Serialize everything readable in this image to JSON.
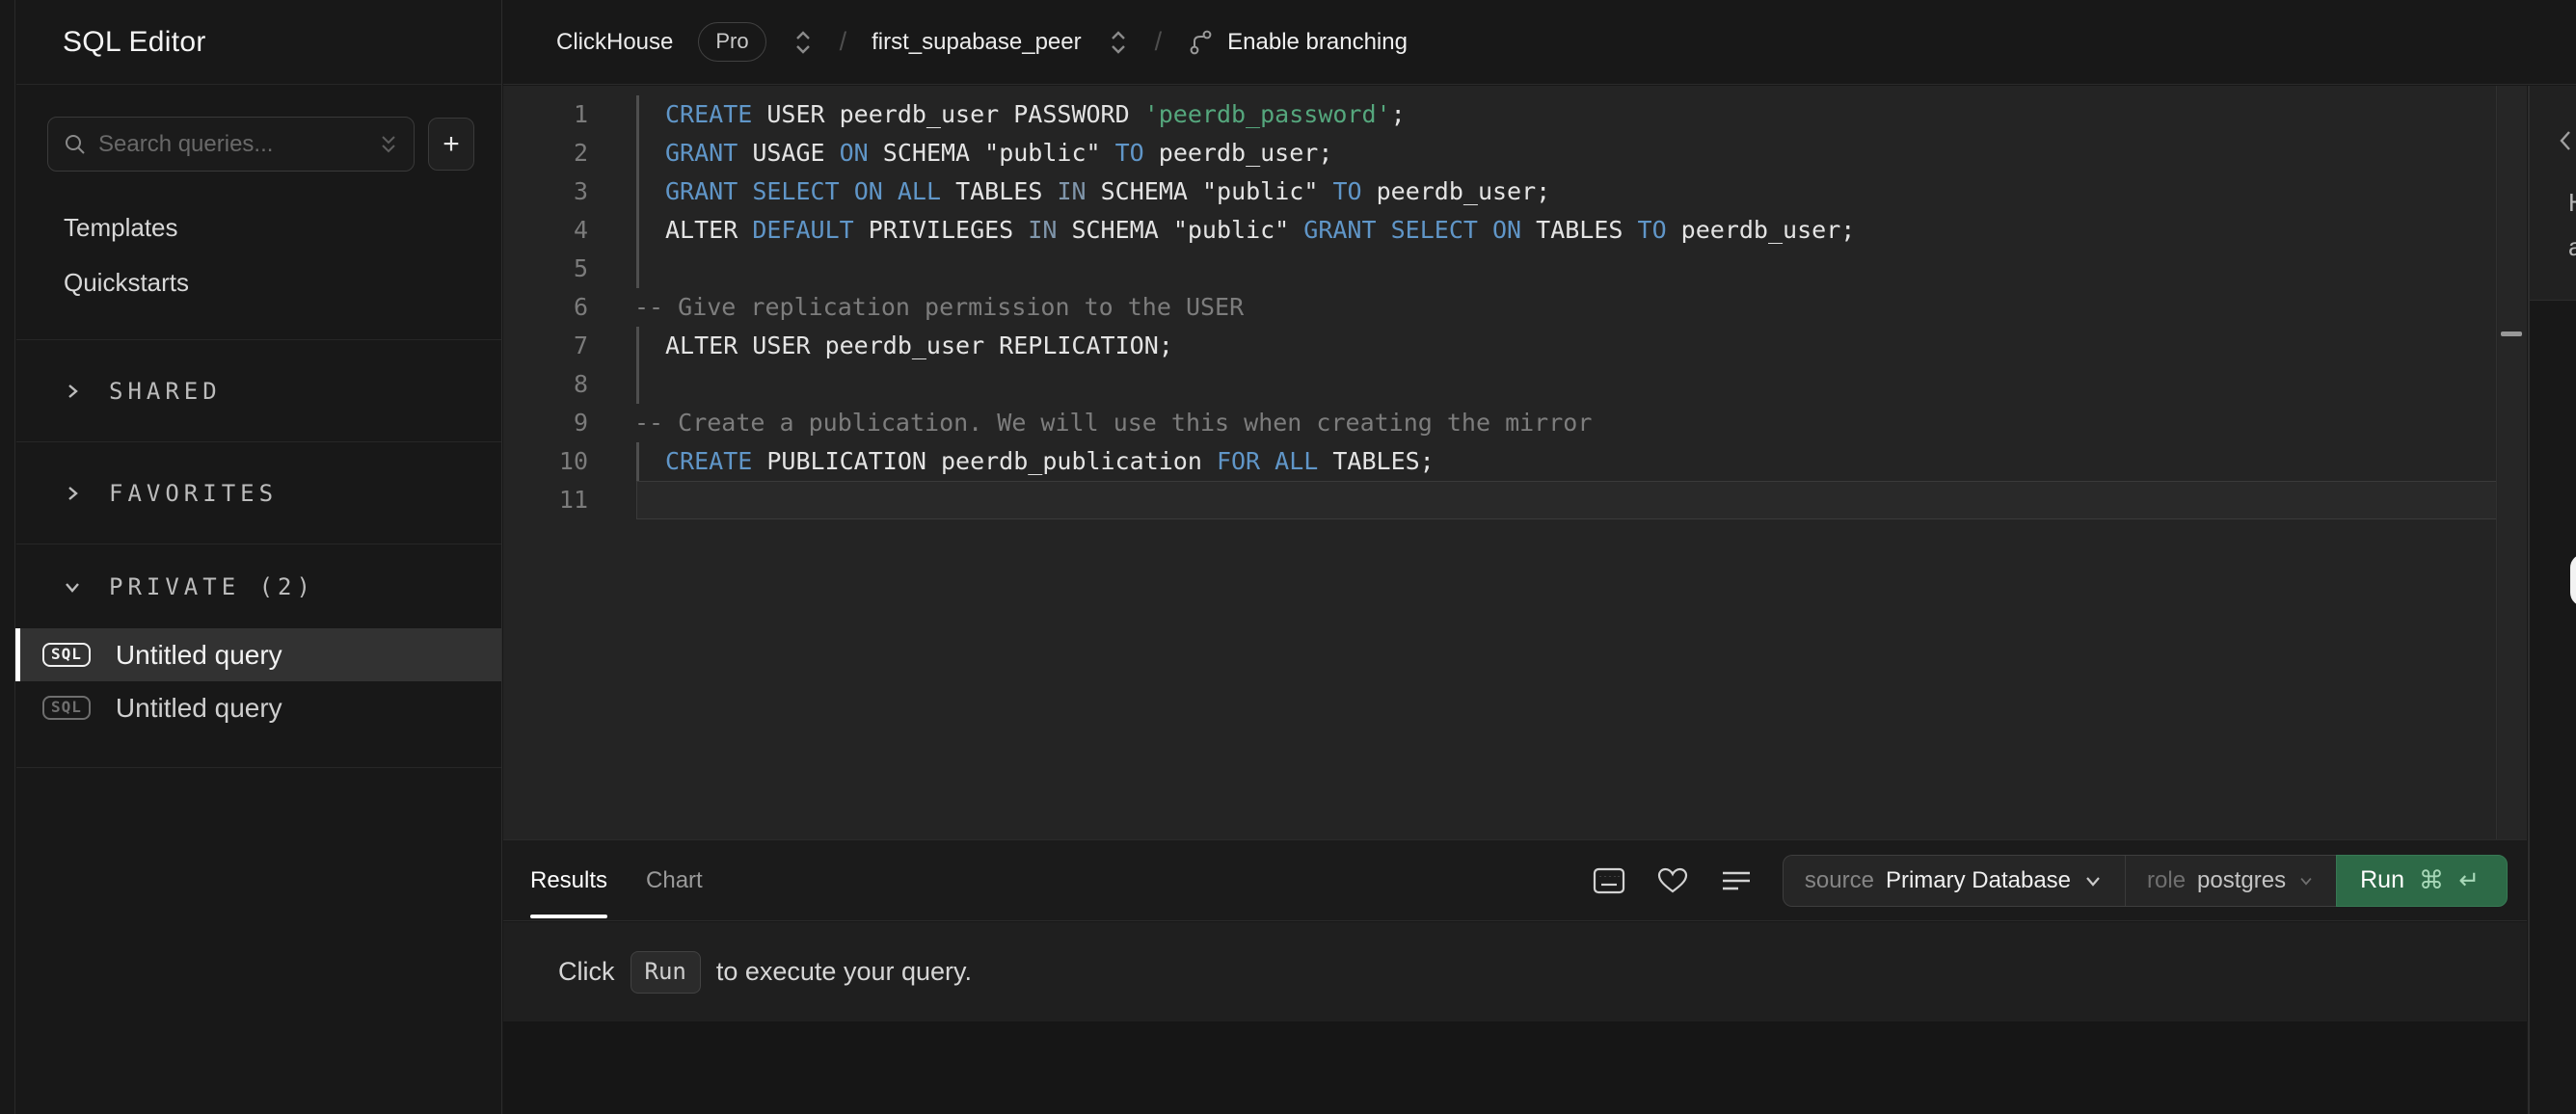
{
  "colors": {
    "keyword_blue": "#6096c8",
    "keyword_muted": "#8096ab",
    "string_green": "#55a77d",
    "comment_gray": "#7d7d7d",
    "run_green": "#2d6a47"
  },
  "sidebar": {
    "title": "SQL Editor",
    "search": {
      "placeholder": "Search queries..."
    },
    "new_query_label": "+",
    "nav": [
      {
        "label": "Templates"
      },
      {
        "label": "Quickstarts"
      }
    ],
    "sections": [
      {
        "label": "SHARED",
        "expanded": false
      },
      {
        "label": "FAVORITES",
        "expanded": false
      },
      {
        "label": "PRIVATE (2)",
        "expanded": true
      }
    ],
    "badge_text": "SQL",
    "queries": [
      {
        "label": "Untitled query",
        "selected": true
      },
      {
        "label": "Untitled query",
        "selected": false
      }
    ]
  },
  "header": {
    "service": "ClickHouse",
    "plan_badge": "Pro",
    "separator": "/",
    "peer_name": "first_supabase_peer",
    "branching_label": "Enable branching"
  },
  "editor": {
    "lines": [
      {
        "n": "1",
        "bar": true,
        "tokens": [
          {
            "c": "kw",
            "t": "CREATE"
          },
          {
            "c": "d",
            "t": " USER peerdb_user PASSWORD "
          },
          {
            "c": "str",
            "t": "'peerdb_password'"
          },
          {
            "c": "d",
            "t": ";"
          }
        ]
      },
      {
        "n": "2",
        "bar": true,
        "tokens": [
          {
            "c": "kw",
            "t": "GRANT"
          },
          {
            "c": "d",
            "t": " USAGE "
          },
          {
            "c": "kw",
            "t": "ON"
          },
          {
            "c": "d",
            "t": " SCHEMA \"public\" "
          },
          {
            "c": "kw",
            "t": "TO"
          },
          {
            "c": "d",
            "t": " peerdb_user;"
          }
        ]
      },
      {
        "n": "3",
        "bar": true,
        "tokens": [
          {
            "c": "kw",
            "t": "GRANT"
          },
          {
            "c": "d",
            "t": " "
          },
          {
            "c": "kw",
            "t": "SELECT"
          },
          {
            "c": "d",
            "t": " "
          },
          {
            "c": "kw",
            "t": "ON"
          },
          {
            "c": "d",
            "t": " "
          },
          {
            "c": "kw",
            "t": "ALL"
          },
          {
            "c": "d",
            "t": " TABLES "
          },
          {
            "c": "kw2",
            "t": "IN"
          },
          {
            "c": "d",
            "t": " SCHEMA \"public\" "
          },
          {
            "c": "kw",
            "t": "TO"
          },
          {
            "c": "d",
            "t": " peerdb_user;"
          }
        ]
      },
      {
        "n": "4",
        "bar": true,
        "tokens": [
          {
            "c": "d",
            "t": "ALTER "
          },
          {
            "c": "kw",
            "t": "DEFAULT"
          },
          {
            "c": "d",
            "t": " PRIVILEGES "
          },
          {
            "c": "kw2",
            "t": "IN"
          },
          {
            "c": "d",
            "t": " SCHEMA \"public\" "
          },
          {
            "c": "kw",
            "t": "GRANT"
          },
          {
            "c": "d",
            "t": " "
          },
          {
            "c": "kw",
            "t": "SELECT"
          },
          {
            "c": "d",
            "t": " "
          },
          {
            "c": "kw",
            "t": "ON"
          },
          {
            "c": "d",
            "t": " TABLES "
          },
          {
            "c": "kw",
            "t": "TO"
          },
          {
            "c": "d",
            "t": " peerdb_user;"
          }
        ]
      },
      {
        "n": "5",
        "bar": true,
        "tokens": []
      },
      {
        "n": "6",
        "bar": false,
        "comment": true,
        "tokens": [
          {
            "c": "cm",
            "t": "-- Give replication permission to the USER"
          }
        ]
      },
      {
        "n": "7",
        "bar": true,
        "tokens": [
          {
            "c": "d",
            "t": "ALTER USER peerdb_user REPLICATION;"
          }
        ]
      },
      {
        "n": "8",
        "bar": true,
        "tokens": []
      },
      {
        "n": "9",
        "bar": false,
        "comment": true,
        "tokens": [
          {
            "c": "cm",
            "t": "-- Create a publication. We will use this when creating the mirror"
          }
        ]
      },
      {
        "n": "10",
        "bar": true,
        "tokens": [
          {
            "c": "kw",
            "t": "CREATE"
          },
          {
            "c": "d",
            "t": " PUBLICATION peerdb_publication "
          },
          {
            "c": "kw",
            "t": "FOR"
          },
          {
            "c": "d",
            "t": " "
          },
          {
            "c": "kw",
            "t": "ALL"
          },
          {
            "c": "d",
            "t": " TABLES;"
          }
        ]
      },
      {
        "n": "11",
        "bar": false,
        "active": true,
        "tokens": []
      }
    ]
  },
  "results_bar": {
    "tabs": [
      {
        "label": "Results",
        "active": true
      },
      {
        "label": "Chart",
        "active": false
      }
    ],
    "source_label": "source",
    "source_value": "Primary Database",
    "role_label": "role",
    "role_value": "postgres",
    "run_label": "Run",
    "run_shortcut": "⌘ ↵"
  },
  "results_message": {
    "prefix": "Click",
    "keycap": "Run",
    "suffix": "to execute your query."
  },
  "right_panel": {
    "fragments": [
      "H",
      "a"
    ]
  }
}
